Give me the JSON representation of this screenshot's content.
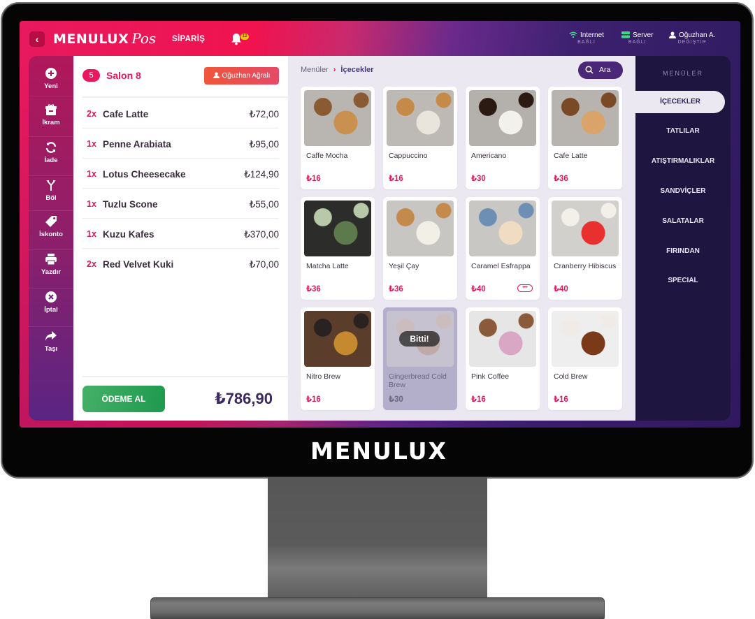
{
  "device": {
    "brand_label": "MENULUX"
  },
  "topbar": {
    "logo_main": "MENULUX",
    "logo_script": "Pos",
    "nav_label": "SİPARİŞ",
    "notification_count": "12",
    "status": [
      {
        "label": "Internet",
        "sub": "BAĞLI",
        "icon": "wifi-icon",
        "color": "#3ddc84"
      },
      {
        "label": "Server",
        "sub": "BAĞLI",
        "icon": "server-icon",
        "color": "#3ddc84"
      },
      {
        "label": "Oğuzhan A.",
        "sub": "DEĞİŞTİR",
        "icon": "user-icon",
        "color": "#ffffff"
      }
    ]
  },
  "rail": {
    "items": [
      {
        "label": "Yeni",
        "icon": "plus-circle-icon"
      },
      {
        "label": "İkram",
        "icon": "gift-icon"
      },
      {
        "label": "İade",
        "icon": "refresh-icon"
      },
      {
        "label": "Böl",
        "icon": "split-icon"
      },
      {
        "label": "İskonto",
        "icon": "tag-icon"
      },
      {
        "label": "Yazdır",
        "icon": "printer-icon"
      },
      {
        "label": "İptal",
        "icon": "cancel-icon"
      },
      {
        "label": "Taşı",
        "icon": "share-arrow-icon"
      }
    ]
  },
  "order": {
    "table_number": "5",
    "table_name": "Salon 8",
    "waiter": "Oğuzhan Ağralı",
    "items": [
      {
        "qty": "2x",
        "name": "Cafe Latte",
        "price": "₺72,00"
      },
      {
        "qty": "1x",
        "name": "Penne Arabiata",
        "price": "₺95,00"
      },
      {
        "qty": "1x",
        "name": "Lotus Cheesecake",
        "price": "₺124,90"
      },
      {
        "qty": "1x",
        "name": "Tuzlu Scone",
        "price": "₺55,00"
      },
      {
        "qty": "1x",
        "name": "Kuzu Kafes",
        "price": "₺370,00"
      },
      {
        "qty": "2x",
        "name": "Red Velvet Kuki",
        "price": "₺70,00"
      }
    ],
    "pay_label": "ÖDEME AL",
    "total": "₺786,90"
  },
  "menu": {
    "breadcrumb": {
      "root": "Menüler",
      "current": "İçecekler"
    },
    "search_label": "Ara",
    "sold_out_label": "Bitti!",
    "products": [
      {
        "name": "Caffe Mocha",
        "price": "₺16",
        "image": "caffe-mocha-photo"
      },
      {
        "name": "Cappuccino",
        "price": "₺16",
        "image": "cappuccino-photo"
      },
      {
        "name": "Americano",
        "price": "₺30",
        "image": "americano-photo"
      },
      {
        "name": "Cafe Latte",
        "price": "₺36",
        "image": "cafe-latte-photo"
      },
      {
        "name": "Matcha Latte",
        "price": "₺36",
        "image": "matcha-latte-photo"
      },
      {
        "name": "Yeşil Çay",
        "price": "₺36",
        "image": "green-tea-photo"
      },
      {
        "name": "Caramel Esfrappa",
        "price": "₺40",
        "image": "caramel-esfrappa-photo",
        "has_options": true
      },
      {
        "name": "Cranberry Hibiscus",
        "price": "₺40",
        "image": "cranberry-hibiscus-photo"
      },
      {
        "name": "Nitro Brew",
        "price": "₺16",
        "image": "nitro-brew-photo"
      },
      {
        "name": "Gingerbread Cold Brew",
        "price": "₺30",
        "image": "gingerbread-cold-brew-photo",
        "sold_out": true
      },
      {
        "name": "Pink Coffee",
        "price": "₺16",
        "image": "pink-coffee-photo"
      },
      {
        "name": "Cold Brew",
        "price": "₺16",
        "image": "cold-brew-photo"
      }
    ]
  },
  "categories": {
    "title": "MENÜLER",
    "active": "İÇECEKLER",
    "items": [
      "İÇECEKLER",
      "TATLILAR",
      "ATIŞTIRMALIKLAR",
      "SANDVİÇLER",
      "SALATALAR",
      "FIRINDAN",
      "SPECIAL"
    ]
  },
  "colors": {
    "accent_pink": "#e4155c",
    "brand_purple": "#4b2778",
    "pay_green": "#1e9a4e",
    "sidebar_dark": "#1f1541"
  }
}
